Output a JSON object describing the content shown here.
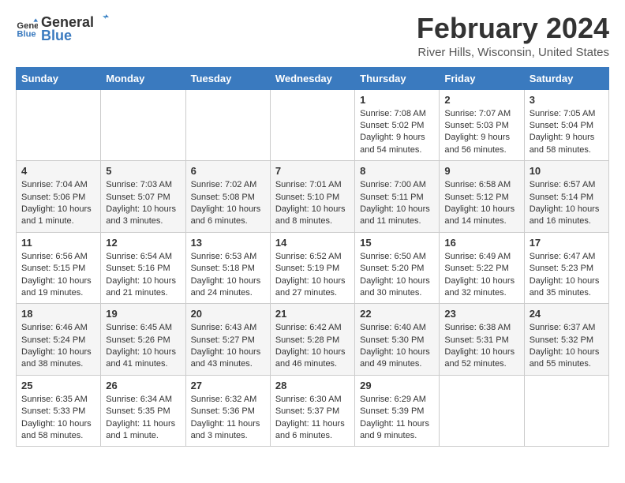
{
  "app": {
    "logo_general": "General",
    "logo_blue": "Blue"
  },
  "header": {
    "month_year": "February 2024",
    "location": "River Hills, Wisconsin, United States"
  },
  "calendar": {
    "days_of_week": [
      "Sunday",
      "Monday",
      "Tuesday",
      "Wednesday",
      "Thursday",
      "Friday",
      "Saturday"
    ],
    "weeks": [
      [
        {
          "day": "",
          "content": ""
        },
        {
          "day": "",
          "content": ""
        },
        {
          "day": "",
          "content": ""
        },
        {
          "day": "",
          "content": ""
        },
        {
          "day": "1",
          "content": "Sunrise: 7:08 AM\nSunset: 5:02 PM\nDaylight: 9 hours and 54 minutes."
        },
        {
          "day": "2",
          "content": "Sunrise: 7:07 AM\nSunset: 5:03 PM\nDaylight: 9 hours and 56 minutes."
        },
        {
          "day": "3",
          "content": "Sunrise: 7:05 AM\nSunset: 5:04 PM\nDaylight: 9 hours and 58 minutes."
        }
      ],
      [
        {
          "day": "4",
          "content": "Sunrise: 7:04 AM\nSunset: 5:06 PM\nDaylight: 10 hours and 1 minute."
        },
        {
          "day": "5",
          "content": "Sunrise: 7:03 AM\nSunset: 5:07 PM\nDaylight: 10 hours and 3 minutes."
        },
        {
          "day": "6",
          "content": "Sunrise: 7:02 AM\nSunset: 5:08 PM\nDaylight: 10 hours and 6 minutes."
        },
        {
          "day": "7",
          "content": "Sunrise: 7:01 AM\nSunset: 5:10 PM\nDaylight: 10 hours and 8 minutes."
        },
        {
          "day": "8",
          "content": "Sunrise: 7:00 AM\nSunset: 5:11 PM\nDaylight: 10 hours and 11 minutes."
        },
        {
          "day": "9",
          "content": "Sunrise: 6:58 AM\nSunset: 5:12 PM\nDaylight: 10 hours and 14 minutes."
        },
        {
          "day": "10",
          "content": "Sunrise: 6:57 AM\nSunset: 5:14 PM\nDaylight: 10 hours and 16 minutes."
        }
      ],
      [
        {
          "day": "11",
          "content": "Sunrise: 6:56 AM\nSunset: 5:15 PM\nDaylight: 10 hours and 19 minutes."
        },
        {
          "day": "12",
          "content": "Sunrise: 6:54 AM\nSunset: 5:16 PM\nDaylight: 10 hours and 21 minutes."
        },
        {
          "day": "13",
          "content": "Sunrise: 6:53 AM\nSunset: 5:18 PM\nDaylight: 10 hours and 24 minutes."
        },
        {
          "day": "14",
          "content": "Sunrise: 6:52 AM\nSunset: 5:19 PM\nDaylight: 10 hours and 27 minutes."
        },
        {
          "day": "15",
          "content": "Sunrise: 6:50 AM\nSunset: 5:20 PM\nDaylight: 10 hours and 30 minutes."
        },
        {
          "day": "16",
          "content": "Sunrise: 6:49 AM\nSunset: 5:22 PM\nDaylight: 10 hours and 32 minutes."
        },
        {
          "day": "17",
          "content": "Sunrise: 6:47 AM\nSunset: 5:23 PM\nDaylight: 10 hours and 35 minutes."
        }
      ],
      [
        {
          "day": "18",
          "content": "Sunrise: 6:46 AM\nSunset: 5:24 PM\nDaylight: 10 hours and 38 minutes."
        },
        {
          "day": "19",
          "content": "Sunrise: 6:45 AM\nSunset: 5:26 PM\nDaylight: 10 hours and 41 minutes."
        },
        {
          "day": "20",
          "content": "Sunrise: 6:43 AM\nSunset: 5:27 PM\nDaylight: 10 hours and 43 minutes."
        },
        {
          "day": "21",
          "content": "Sunrise: 6:42 AM\nSunset: 5:28 PM\nDaylight: 10 hours and 46 minutes."
        },
        {
          "day": "22",
          "content": "Sunrise: 6:40 AM\nSunset: 5:30 PM\nDaylight: 10 hours and 49 minutes."
        },
        {
          "day": "23",
          "content": "Sunrise: 6:38 AM\nSunset: 5:31 PM\nDaylight: 10 hours and 52 minutes."
        },
        {
          "day": "24",
          "content": "Sunrise: 6:37 AM\nSunset: 5:32 PM\nDaylight: 10 hours and 55 minutes."
        }
      ],
      [
        {
          "day": "25",
          "content": "Sunrise: 6:35 AM\nSunset: 5:33 PM\nDaylight: 10 hours and 58 minutes."
        },
        {
          "day": "26",
          "content": "Sunrise: 6:34 AM\nSunset: 5:35 PM\nDaylight: 11 hours and 1 minute."
        },
        {
          "day": "27",
          "content": "Sunrise: 6:32 AM\nSunset: 5:36 PM\nDaylight: 11 hours and 3 minutes."
        },
        {
          "day": "28",
          "content": "Sunrise: 6:30 AM\nSunset: 5:37 PM\nDaylight: 11 hours and 6 minutes."
        },
        {
          "day": "29",
          "content": "Sunrise: 6:29 AM\nSunset: 5:39 PM\nDaylight: 11 hours and 9 minutes."
        },
        {
          "day": "",
          "content": ""
        },
        {
          "day": "",
          "content": ""
        }
      ]
    ]
  }
}
